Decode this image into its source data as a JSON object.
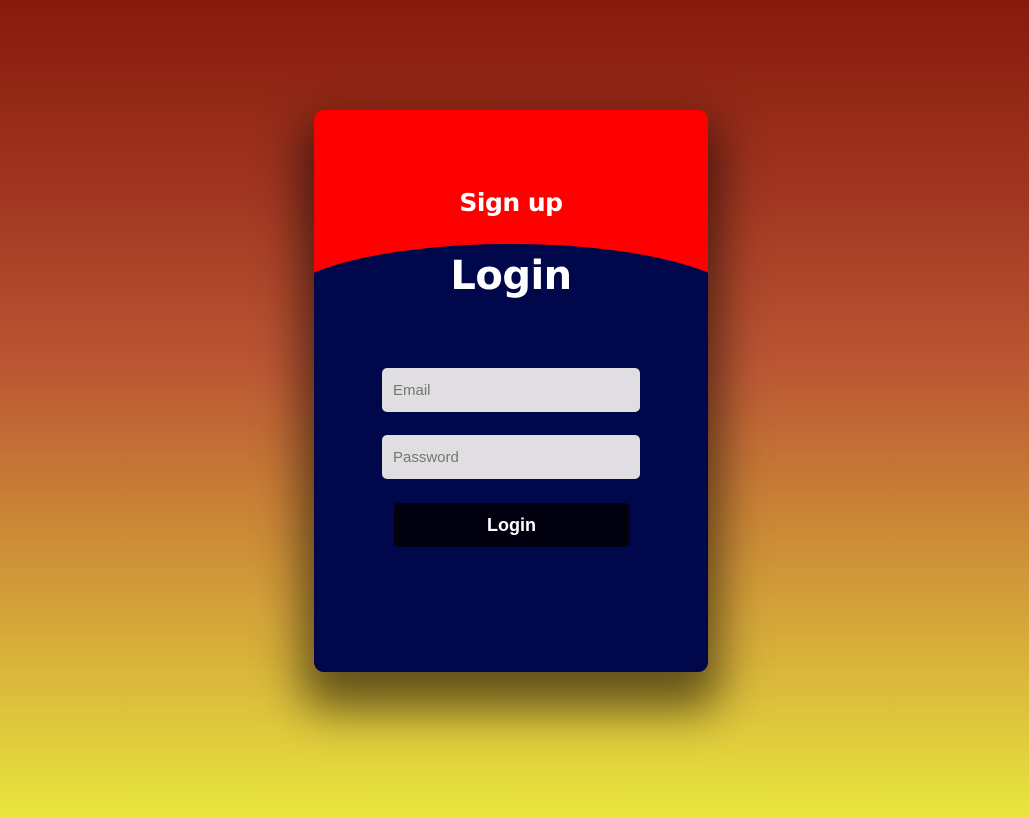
{
  "signup": {
    "title": "Sign up"
  },
  "login": {
    "title": "Login",
    "email_placeholder": "Email",
    "password_placeholder": "Password",
    "button_label": "Login"
  },
  "colors": {
    "signup_panel": "#ff0000",
    "login_panel": "#00074b",
    "button": "#02010f",
    "input_background": "#e0dee0"
  }
}
